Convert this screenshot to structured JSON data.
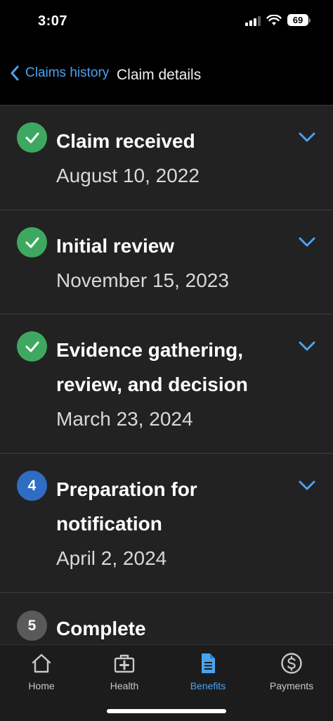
{
  "status_bar": {
    "time": "3:07",
    "battery": "69"
  },
  "nav": {
    "back_label": "Claims history",
    "title": "Claim details"
  },
  "steps": [
    {
      "title": "Claim received",
      "date": "August 10, 2022",
      "status": "complete"
    },
    {
      "title": "Initial review",
      "date": "November 15, 2023",
      "status": "complete"
    },
    {
      "title": "Evidence gathering, review, and decision",
      "date": "March 23, 2024",
      "status": "complete"
    },
    {
      "number": "4",
      "title": "Preparation for notification",
      "date": "April 2, 2024",
      "status": "current"
    },
    {
      "number": "5",
      "title": "Complete",
      "status": "upcoming"
    }
  ],
  "tabs": [
    {
      "label": "Home",
      "icon": "home-icon"
    },
    {
      "label": "Health",
      "icon": "medical-kit-icon"
    },
    {
      "label": "Benefits",
      "icon": "document-icon",
      "active": true
    },
    {
      "label": "Payments",
      "icon": "dollar-circle-icon"
    }
  ],
  "colors": {
    "accent": "#4aa3f0",
    "complete": "#3fa860",
    "current": "#2f6dc4",
    "upcoming": "#5a5a5a"
  }
}
